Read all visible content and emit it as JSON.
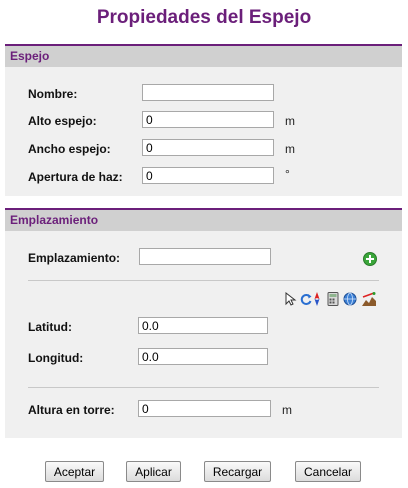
{
  "title": "Propiedades del Espejo",
  "espejo": {
    "header": "Espejo",
    "nombre": {
      "label": "Nombre:",
      "value": ""
    },
    "alto": {
      "label": "Alto espejo:",
      "value": "0",
      "unit": "m"
    },
    "ancho": {
      "label": "Ancho espejo:",
      "value": "0",
      "unit": "m"
    },
    "apertura": {
      "label": "Apertura de haz:",
      "value": "0",
      "unit": "°"
    }
  },
  "emplazamiento": {
    "header": "Emplazamiento",
    "emplazamiento": {
      "label": "Emplazamiento:",
      "value": ""
    },
    "tools": [
      "pointer-icon",
      "refresh-icon",
      "compass-icon",
      "calculator-icon",
      "globe-icon",
      "terrain-profile-icon"
    ],
    "add_icon": "add-icon",
    "latitud": {
      "label": "Latitud:",
      "value": "0.0"
    },
    "longitud": {
      "label": "Longitud:",
      "value": "0.0"
    },
    "altura": {
      "label": "Altura en torre:",
      "value": "0",
      "unit": "m"
    }
  },
  "buttons": {
    "aceptar": "Aceptar",
    "aplicar": "Aplicar",
    "recargar": "Recargar",
    "cancelar": "Cancelar"
  },
  "colors": {
    "accent": "#6b1f7a",
    "section_bg": "#f0f0f0",
    "header_bg": "#d0d0d0",
    "add_green": "#3aa63a"
  }
}
